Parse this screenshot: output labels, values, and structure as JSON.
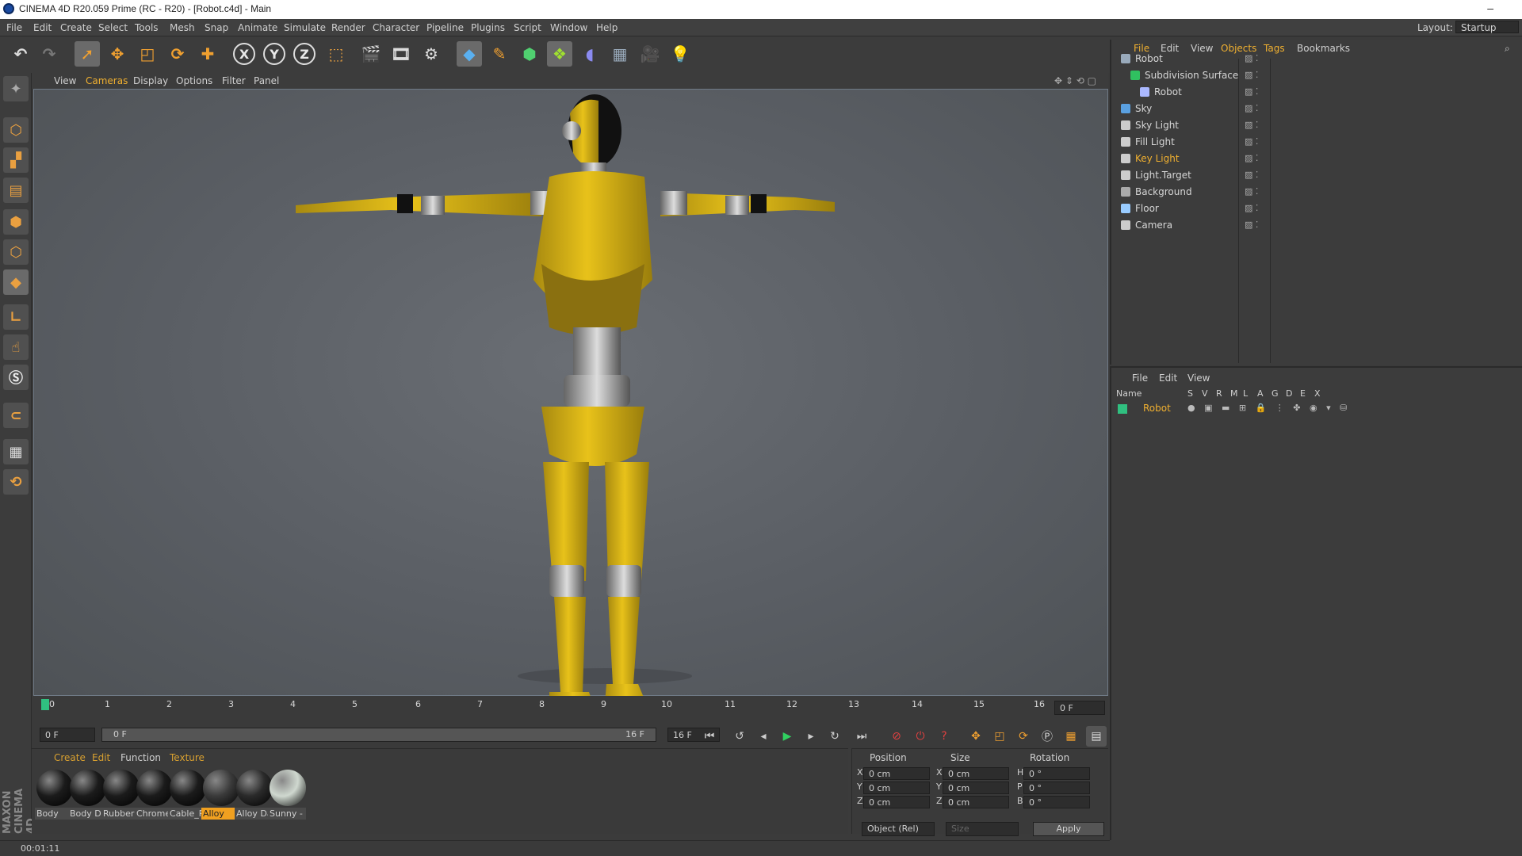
{
  "window": {
    "title": "CINEMA 4D R20.059 Prime (RC - R20) - [Robot.c4d] - Main",
    "layout_label": "Layout:",
    "layout_value": "Startup"
  },
  "menu": [
    "File",
    "Edit",
    "Create",
    "Select",
    "Tools",
    "Mesh",
    "Snap",
    "Animate",
    "Simulate",
    "Render",
    "Character",
    "Pipeline",
    "Plugins",
    "Script",
    "Window",
    "Help"
  ],
  "viewport_menu": [
    "View",
    "Cameras",
    "Display",
    "Options",
    "Filter",
    "Panel"
  ],
  "timeline": {
    "ticks": [
      "0",
      "1",
      "2",
      "3",
      "4",
      "5",
      "6",
      "7",
      "8",
      "9",
      "10",
      "11",
      "12",
      "13",
      "14",
      "15",
      "16"
    ],
    "frame_field": "0 F"
  },
  "playbar": {
    "start_field": "0 F",
    "range_start": "0 F",
    "range_end": "16 F",
    "end_field": "16 F"
  },
  "materials": {
    "menu": [
      "Create",
      "Edit",
      "Function",
      "Texture"
    ],
    "items": [
      {
        "label": "Body",
        "color": "#1b1b1b"
      },
      {
        "label": "Body Da",
        "color": "#1b1b1b"
      },
      {
        "label": "Rubber",
        "color": "#1b1b1b"
      },
      {
        "label": "Chrome",
        "color": "#1b1b1b"
      },
      {
        "label": "Cable_R",
        "color": "#1b1b1b"
      },
      {
        "label": "Alloy",
        "color": "#3a3a3a",
        "selected": true
      },
      {
        "label": "Alloy Da",
        "color": "#2a2a2a"
      },
      {
        "label": "Sunny -",
        "color": "#cfd8cf"
      }
    ]
  },
  "coords": {
    "headers": [
      "Position",
      "Size",
      "Rotation"
    ],
    "rows": [
      {
        "pl": "X",
        "p": "0 cm",
        "sl": "X",
        "s": "0 cm",
        "rl": "H",
        "r": "0 °"
      },
      {
        "pl": "Y",
        "p": "0 cm",
        "sl": "Y",
        "s": "0 cm",
        "rl": "P",
        "r": "0 °"
      },
      {
        "pl": "Z",
        "p": "0 cm",
        "sl": "Z",
        "s": "0 cm",
        "rl": "B",
        "r": "0 °"
      }
    ],
    "mode": "Object (Rel)",
    "size_mode": "Size",
    "apply": "Apply"
  },
  "status": {
    "time": "00:01:11"
  },
  "objects": {
    "menu": [
      "File",
      "Edit",
      "View",
      "Objects",
      "Tags",
      "Bookmarks"
    ],
    "items": [
      {
        "name": "Robot",
        "indent": 0,
        "color": "#d6d6d6"
      },
      {
        "name": "Subdivision Surface",
        "indent": 1,
        "color": "#d6d6d6"
      },
      {
        "name": "Robot",
        "indent": 2,
        "color": "#d6d6d6"
      },
      {
        "name": "Sky",
        "indent": 0,
        "color": "#d6d6d6"
      },
      {
        "name": "Sky Light",
        "indent": 0,
        "color": "#d6d6d6"
      },
      {
        "name": "Fill Light",
        "indent": 0,
        "color": "#d6d6d6"
      },
      {
        "name": "Key Light",
        "indent": 0,
        "color": "#f0b030"
      },
      {
        "name": "Light.Target",
        "indent": 0,
        "color": "#d6d6d6"
      },
      {
        "name": "Background",
        "indent": 0,
        "color": "#d6d6d6"
      },
      {
        "name": "Floor",
        "indent": 0,
        "color": "#d6d6d6"
      },
      {
        "name": "Camera",
        "indent": 0,
        "color": "#d6d6d6"
      }
    ]
  },
  "attributes": {
    "menu": [
      "File",
      "Edit",
      "View"
    ],
    "columns": [
      "Name",
      "S",
      "V",
      "R",
      "M",
      "L",
      "A",
      "G",
      "D",
      "E",
      "X"
    ],
    "row_name": "Robot"
  },
  "colors": {
    "accent": "#f0b030",
    "robot_yellow": "#e8c21a",
    "selection": "#6a6a6a"
  }
}
